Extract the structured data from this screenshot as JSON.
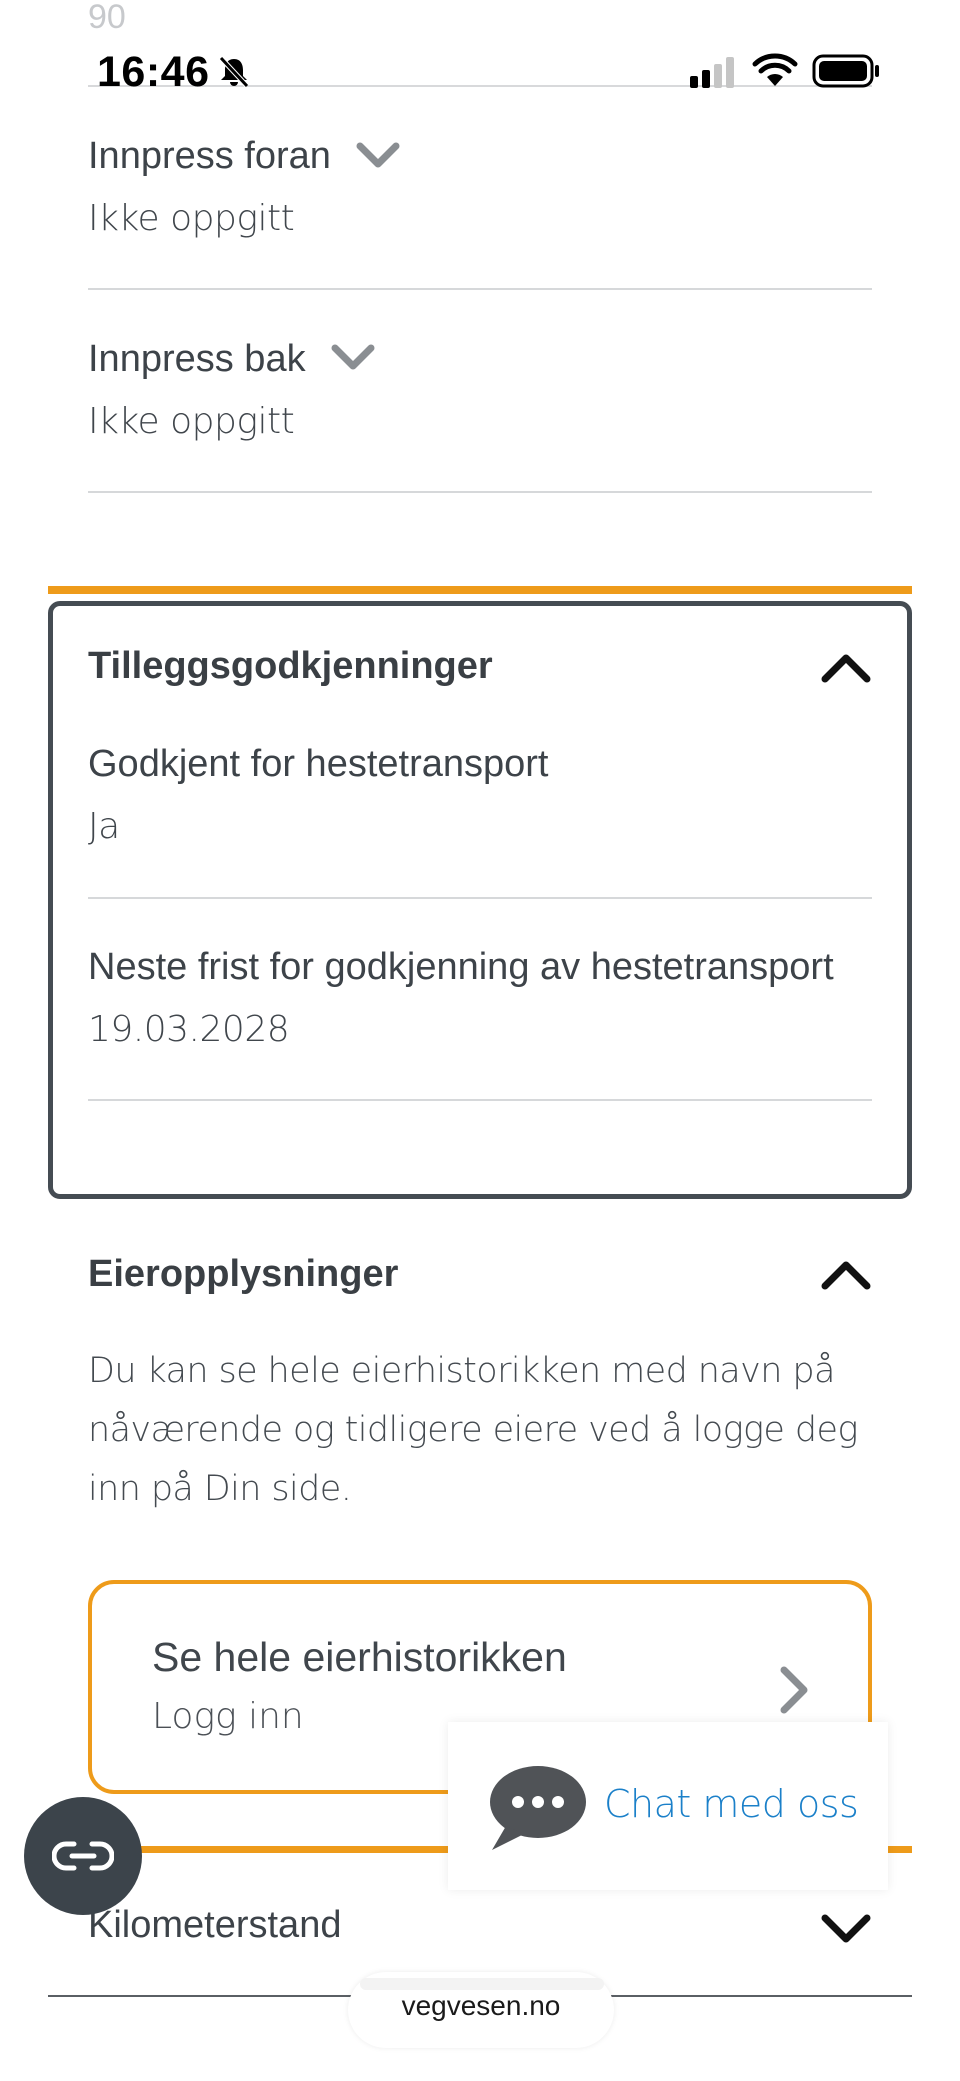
{
  "status_bar": {
    "partial_number": "90",
    "time": "16:46"
  },
  "specs": [
    {
      "label": "Innpress foran",
      "value": "Ikke oppgitt"
    },
    {
      "label": "Innpress bak",
      "value": "Ikke oppgitt"
    }
  ],
  "tilleggsgodkjenninger": {
    "title": "Tilleggsgodkjenninger",
    "items": [
      {
        "label": "Godkjent for hestetransport",
        "value": "Ja"
      },
      {
        "label": "Neste frist for godkjenning av hestetransport",
        "value": "19.03.2028"
      }
    ]
  },
  "eieropplysninger": {
    "title": "Eieropplysninger",
    "text_lines": [
      "Du kan se hele eierhistorikken med navn på",
      "nåværende og tidligere eiere ved å logge deg",
      "inn på Din side."
    ],
    "link_title": "Se hele eierhistorikken",
    "link_subtitle": "Logg inn"
  },
  "chat": {
    "label": "Chat med oss"
  },
  "kilometerstand": {
    "title": "Kilometerstand"
  },
  "browser": {
    "url": "vegvesen.no"
  },
  "colors": {
    "accent": "#ee9b1a",
    "link": "#1b80c9",
    "card_border": "#454c53"
  },
  "icons": [
    "bell-muted-icon",
    "signal-icon",
    "wifi-icon",
    "battery-icon",
    "chevron-down-icon",
    "chevron-up-icon",
    "chevron-right-icon",
    "chat-bubble-icon",
    "reader-mode-icon"
  ]
}
